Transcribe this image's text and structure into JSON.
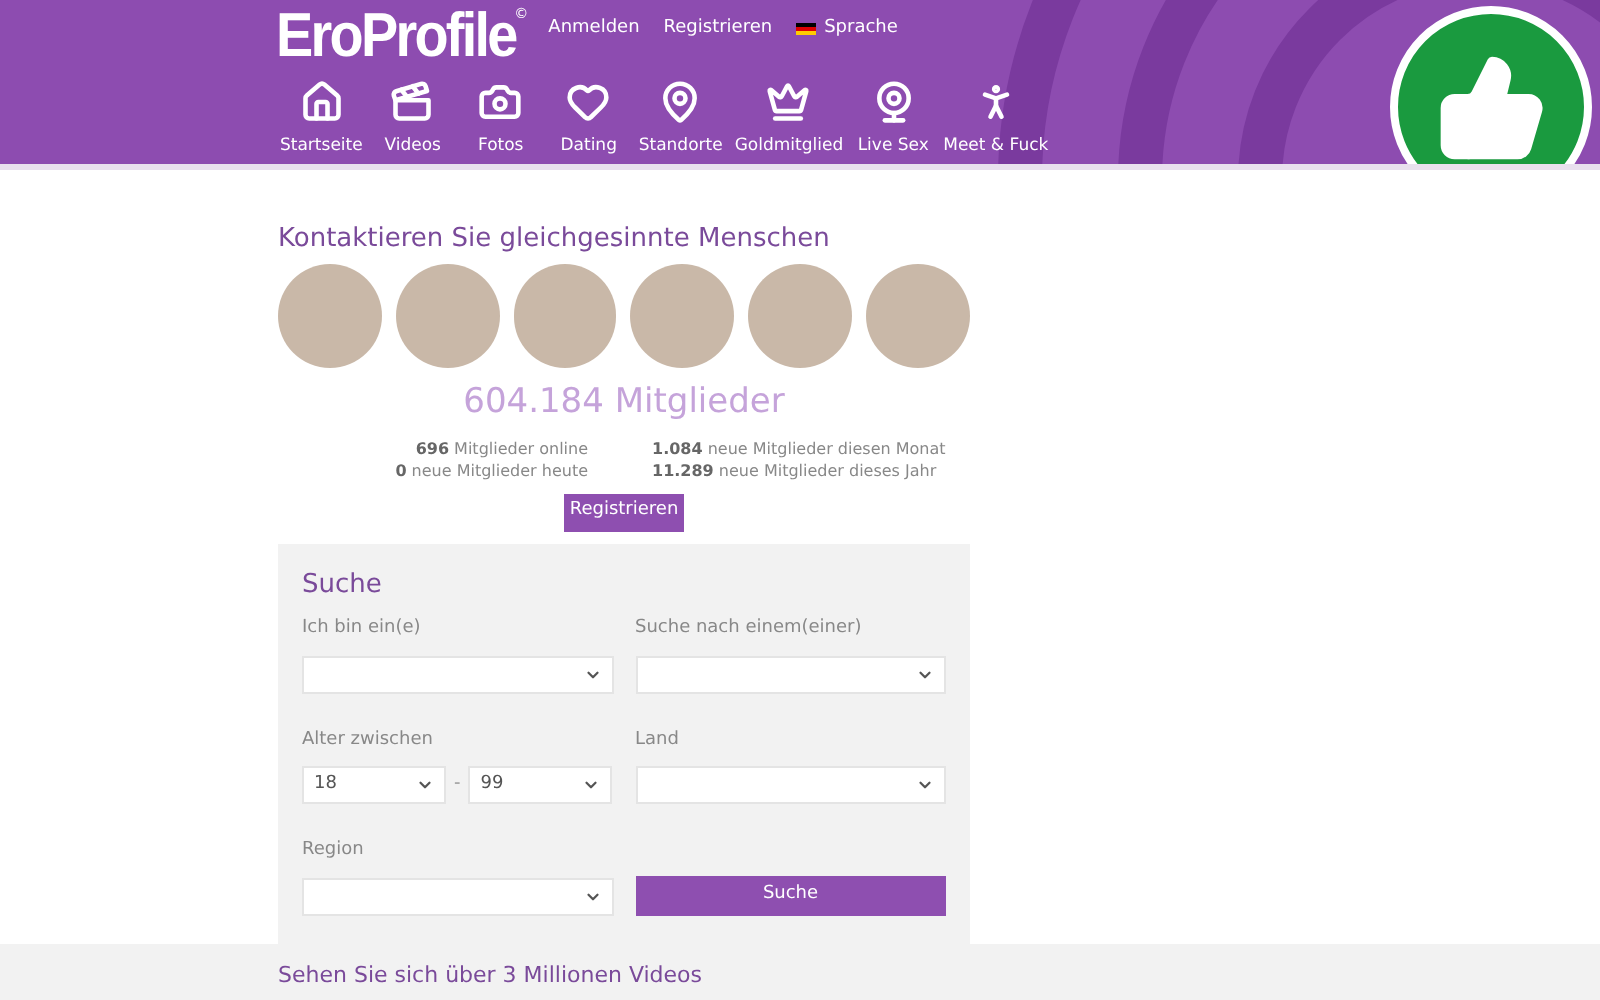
{
  "header": {
    "logo": "EroProfile",
    "logo_mark": "©",
    "links": [
      "Anmelden",
      "Registrieren"
    ],
    "language": "Sprache",
    "nav": [
      {
        "label": "Startseite"
      },
      {
        "label": "Videos"
      },
      {
        "label": "Fotos"
      },
      {
        "label": "Dating"
      },
      {
        "label": "Standorte"
      },
      {
        "label": "Goldmitglied"
      },
      {
        "label": "Live Sex"
      },
      {
        "label": "Meet & Fuck"
      }
    ]
  },
  "contact": {
    "title": "Kontaktieren Sie gleichgesinnte Menschen",
    "members": "604.184 Mitglieder",
    "stats_left": [
      "**696** Mitglieder online",
      "**0** neue Mitglieder heute"
    ],
    "stats_right": [
      "**1.084** neue Mitglieder diesen Monat",
      "**11.289** neue Mitglieder dieses Jahr"
    ],
    "register": "Registrieren"
  },
  "search": {
    "title": "Suche",
    "fields": [
      {
        "kind": "select",
        "label": "Ich bin ein(e)"
      },
      {
        "kind": "select",
        "label": "Suche nach einem(einer)"
      },
      {
        "kind": "range",
        "label": "Alter zwischen",
        "from": "18",
        "separator": "-",
        "to": "99"
      },
      {
        "kind": "select",
        "label": "Land"
      },
      {
        "kind": "select",
        "label": "Region"
      },
      {
        "kind": "button",
        "label": "Suche"
      }
    ]
  },
  "section": {
    "title": "Sehen Sie sich über 3 Millionen Videos"
  }
}
